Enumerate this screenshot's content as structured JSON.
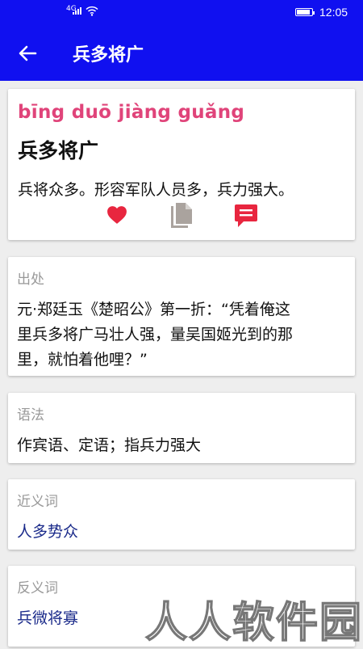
{
  "status_bar": {
    "network": "4G",
    "time": "12:05"
  },
  "app_bar": {
    "back_icon": "arrow-left-icon",
    "title": "兵多将广"
  },
  "entry": {
    "pinyin": "bīng duō jiàng guǎng",
    "word": "兵多将广",
    "meaning": "兵将众多。形容军队人员多，兵力强大。",
    "actions": [
      {
        "icon": "heart-icon",
        "color": "#e8263f"
      },
      {
        "icon": "copy-icon",
        "color": "#aaa39e"
      },
      {
        "icon": "comment-icon",
        "color": "#e8263f"
      }
    ]
  },
  "sections": {
    "source": {
      "label": "出处",
      "lines": [
        "元·郑廷玉《楚昭公》第一折：“凭着俺这",
        "里兵多将广马壮人强，量吴国姬光到的那",
        "里，就怕着他哩？”"
      ]
    },
    "grammar": {
      "label": "语法",
      "text": "作宾语、定语；指兵力强大"
    },
    "synonym": {
      "label": "近义词",
      "text": "人多势众"
    },
    "antonym": {
      "label": "反义词",
      "text": "兵微将寡"
    }
  },
  "watermark": "人人软件园",
  "colors": {
    "primary": "#1010f0",
    "pinyin": "#e0447a",
    "accent": "#e8263f",
    "link_text": "#1a2a8a",
    "label": "#999999"
  }
}
